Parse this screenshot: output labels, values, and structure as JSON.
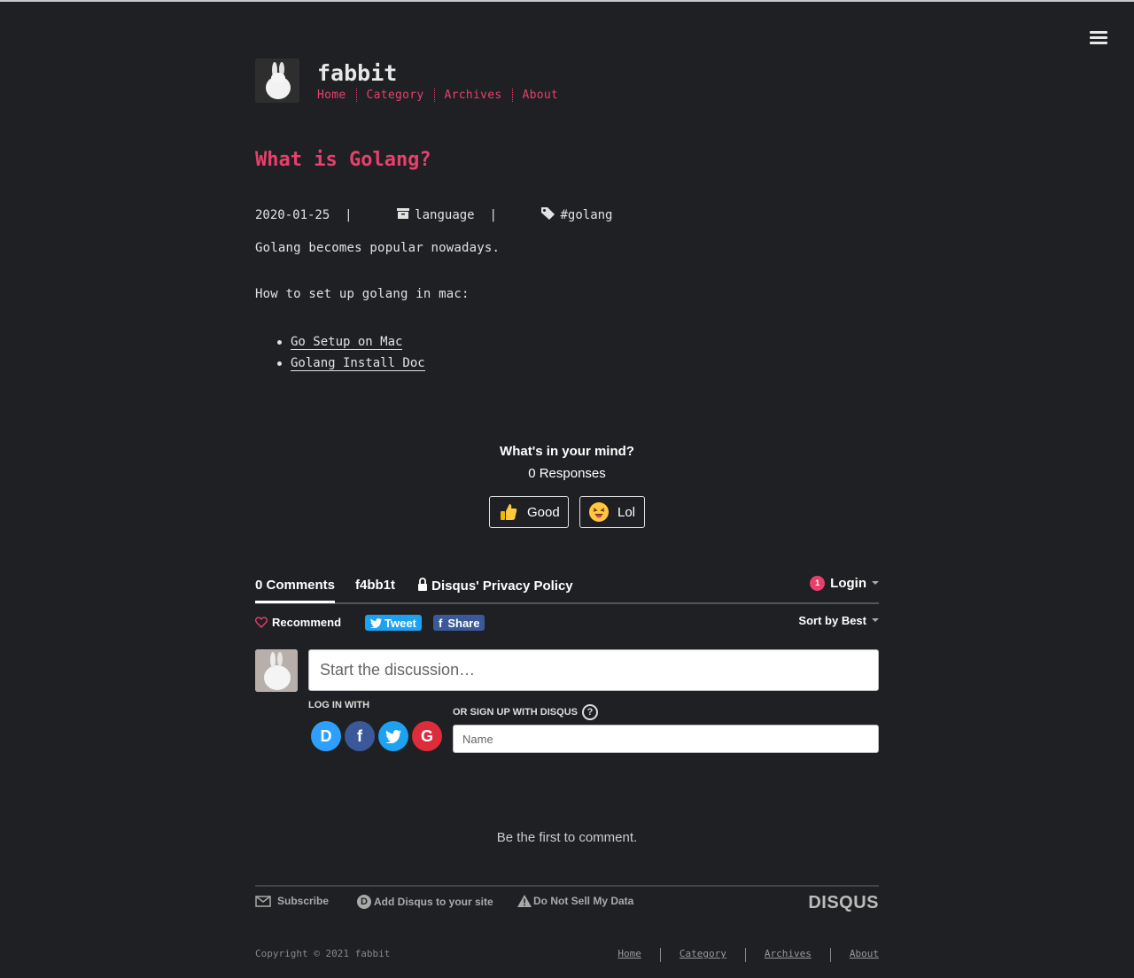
{
  "site": {
    "title": "fabbit",
    "nav": [
      "Home",
      "Category",
      "Archives",
      "About"
    ]
  },
  "post": {
    "title": "What is Golang?",
    "date": "2020-01-25",
    "category": "language",
    "tag": "#golang",
    "intro": "Golang becomes popular nowadays.",
    "howto": "How to set up golang in mac:",
    "links": [
      "Go Setup on Mac",
      "Golang Install Doc"
    ]
  },
  "reactions": {
    "title": "What's in your mind?",
    "count": "0 Responses",
    "buttons": [
      {
        "label": "Good",
        "icon": "thumbs-up-icon"
      },
      {
        "label": "Lol",
        "icon": "laughing-face-icon"
      }
    ]
  },
  "disqus": {
    "tabs": {
      "comments": "0 Comments",
      "community": "f4bb1t",
      "privacy": "Disqus' Privacy Policy",
      "login_badge": "1",
      "login": "Login"
    },
    "bar": {
      "recommend": "Recommend",
      "tweet": "Tweet",
      "share": "Share",
      "sort": "Sort by Best"
    },
    "compose_placeholder": "Start the discussion…",
    "log_in_with": "LOG IN WITH",
    "sign_up": "OR SIGN UP WITH DISQUS",
    "name_placeholder": "Name",
    "empty": "Be the first to comment.",
    "footer": {
      "subscribe": "Subscribe",
      "add": "Add Disqus to your site",
      "dnsmd": "Do Not Sell My Data",
      "brand": "DISQUS"
    },
    "colors": {
      "twitter": "#1da1f2",
      "facebook": "#3b5998",
      "google": "#dd4b39",
      "disqus": "#2e9fff",
      "accent": "#e8406c"
    }
  },
  "footer": {
    "copyright": "Copyright © 2021 fabbit",
    "nav": [
      "Home",
      "Category",
      "Archives",
      "About"
    ]
  }
}
